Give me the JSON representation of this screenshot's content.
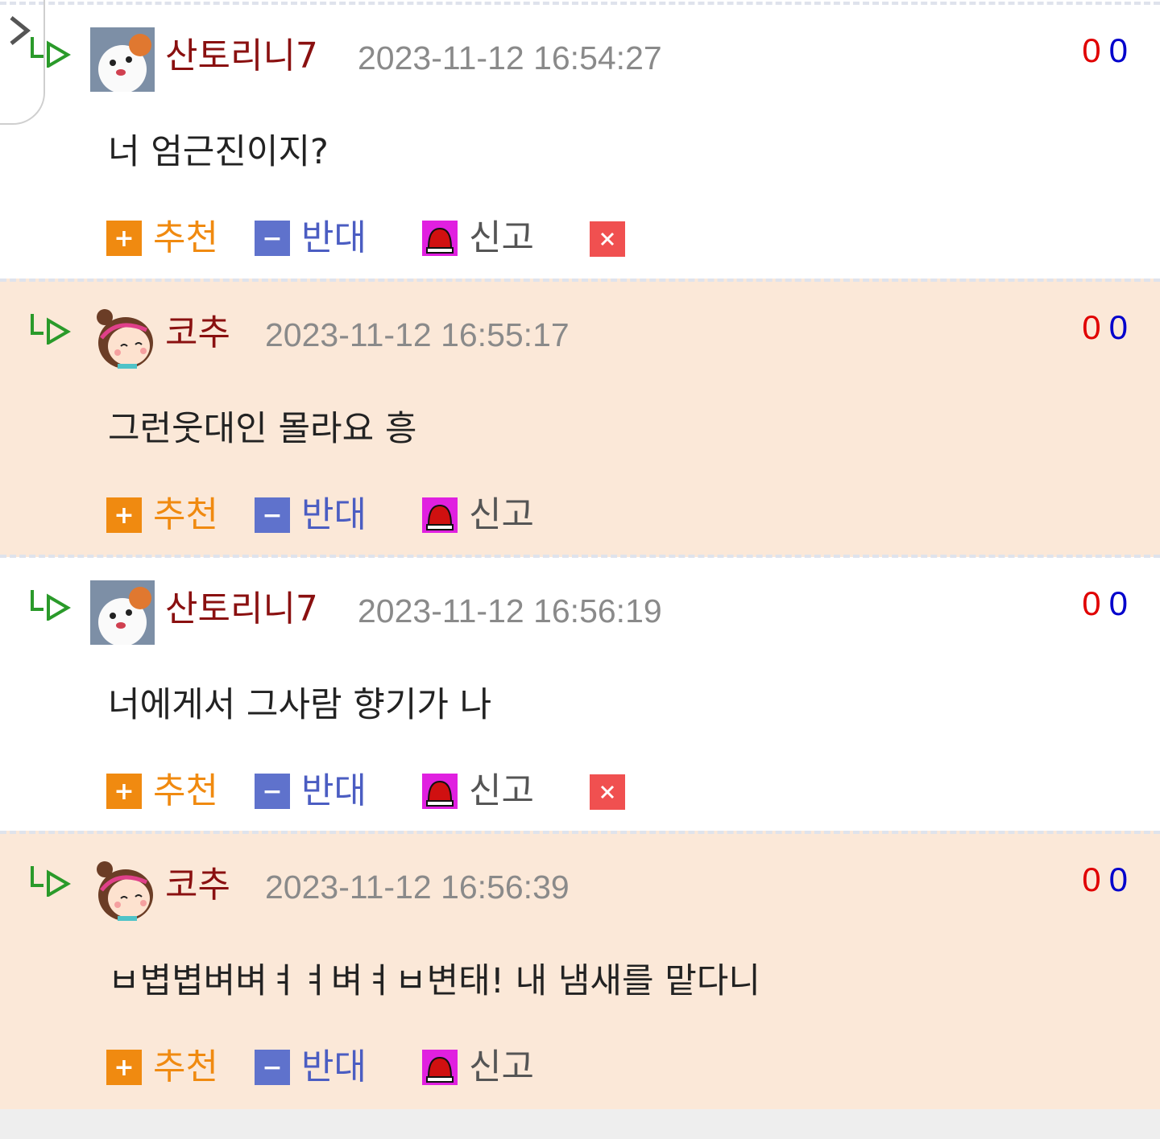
{
  "comments": [
    {
      "nick": "산토리니7",
      "date": "2023-11-12 16:54:27",
      "body": "너 엄근진이지?",
      "up": "0",
      "down": "0",
      "avatar": "hamster-avatar",
      "can_delete": true
    },
    {
      "nick": "코추",
      "date": "2023-11-12 16:55:17",
      "body": "그런웃대인 몰라요 흥",
      "up": "0",
      "down": "0",
      "avatar": "girl-avatar",
      "can_delete": false
    },
    {
      "nick": "산토리니7",
      "date": "2023-11-12 16:56:19",
      "body": "너에게서 그사람 향기가 나",
      "up": "0",
      "down": "0",
      "avatar": "hamster-avatar",
      "can_delete": true
    },
    {
      "nick": "코추",
      "date": "2023-11-12 16:56:39",
      "body": "ㅂ볍볍벼벼ㅕㅕ벼ㅕㅂ변태! 내 냄새를 맡다니",
      "up": "0",
      "down": "0",
      "avatar": "girl-avatar",
      "can_delete": false
    }
  ],
  "actions": {
    "recommend": "추천",
    "oppose": "반대",
    "report": "신고"
  },
  "colors": {
    "alt_background": "#fbe8d8",
    "nick": "#8a1010",
    "recommend": "#f08a10",
    "oppose": "#4b5dc2",
    "vote_up": "#e00000",
    "vote_down": "#0000cc",
    "delete": "#f05050"
  }
}
